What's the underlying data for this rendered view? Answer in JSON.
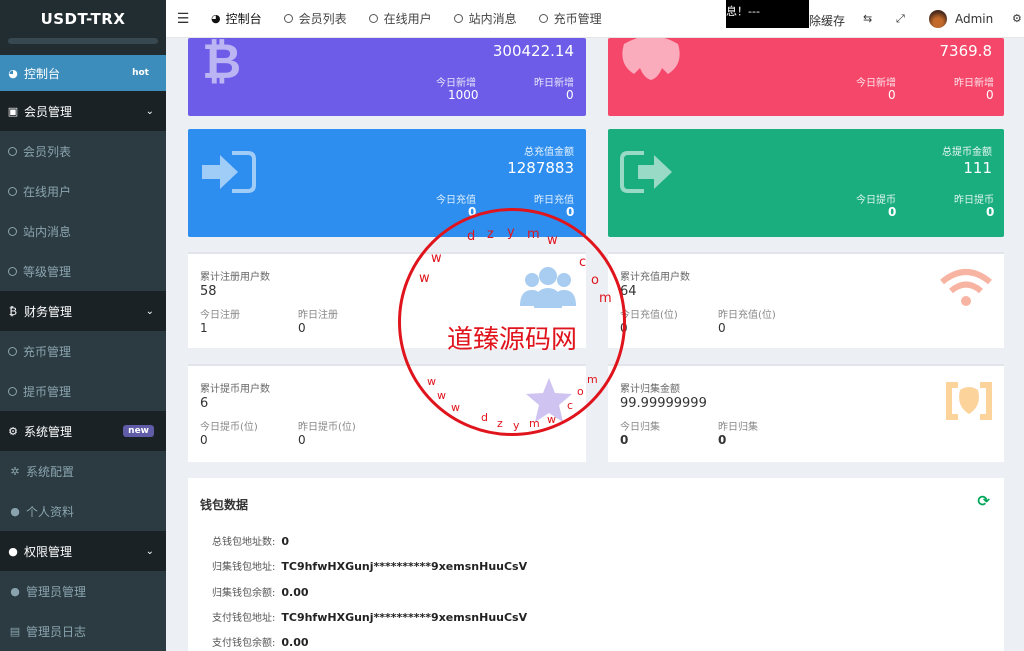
{
  "brand": "USDT-TRX",
  "sidebar": {
    "items": [
      {
        "label": "控制台",
        "badge": "hot",
        "type": "active",
        "icon": "dashboard-icon"
      },
      {
        "label": "会员管理",
        "type": "group",
        "icon": "user-card-icon"
      },
      {
        "label": "会员列表",
        "type": "sub"
      },
      {
        "label": "在线用户",
        "type": "sub"
      },
      {
        "label": "站内消息",
        "type": "sub"
      },
      {
        "label": "等级管理",
        "type": "sub"
      },
      {
        "label": "财务管理",
        "type": "group",
        "icon": "bitcoin-icon"
      },
      {
        "label": "充币管理",
        "type": "sub"
      },
      {
        "label": "提币管理",
        "type": "sub"
      },
      {
        "label": "系统管理",
        "badge": "new",
        "type": "group",
        "icon": "cogs-icon"
      },
      {
        "label": "系统配置",
        "type": "sub",
        "icon": "gear-icon"
      },
      {
        "label": "个人资料",
        "type": "sub",
        "icon": "user-icon"
      },
      {
        "label": "权限管理",
        "type": "group",
        "icon": "users-icon"
      },
      {
        "label": "管理员管理",
        "type": "sub",
        "icon": "user-icon"
      },
      {
        "label": "管理员日志",
        "type": "sub",
        "icon": "list-icon"
      }
    ]
  },
  "topbar": {
    "tabs": [
      "控制台",
      "会员列表",
      "在线用户",
      "站内消息",
      "充币管理"
    ],
    "notice": "息！---",
    "cache": "除缓存",
    "admin": "Admin"
  },
  "cards": {
    "users": {
      "total": "300422.14",
      "today_label": "今日新增",
      "today": "1000",
      "yesterday_label": "昨日新增",
      "yesterday": "0",
      "color": "#6c5ce7"
    },
    "assets": {
      "total": "7369.8",
      "today_label": "今日新增",
      "today": "0",
      "yesterday_label": "昨日新增",
      "yesterday": "0",
      "color": "#f5476a"
    },
    "recharge": {
      "total_label": "总充值金额",
      "total": "1287883",
      "today_label": "今日充值",
      "today": "0",
      "yesterday_label": "昨日充值",
      "yesterday": "0",
      "color": "#2d8ef0"
    },
    "withdraw": {
      "total_label": "总提币金额",
      "total": "111",
      "today_label": "今日提币",
      "today": "0",
      "yesterday_label": "昨日提币",
      "yesterday": "0",
      "color": "#1aae7e"
    }
  },
  "stats": {
    "reg": {
      "title": "累计注册用户数",
      "value": "58",
      "today_label": "今日注册",
      "today": "1",
      "yesterday_label": "昨日注册",
      "yesterday": "0"
    },
    "charge_users": {
      "title": "累计充值用户数",
      "value": "64",
      "today_label": "今日充值(位)",
      "today": "0",
      "yesterday_label": "昨日充值(位)",
      "yesterday": "0"
    },
    "withdraw_users": {
      "title": "累计提币用户数",
      "value": "6",
      "today_label": "今日提币(位)",
      "today": "0",
      "yesterday_label": "昨日提币(位)",
      "yesterday": "0"
    },
    "collect": {
      "title": "累计归集金额",
      "value": "99.99999999",
      "today_label": "今日归集",
      "today": "0",
      "yesterday_label": "昨日归集",
      "yesterday": "0"
    }
  },
  "wallet": {
    "title": "钱包数据",
    "rows": [
      {
        "label": "总钱包地址数:",
        "value": "0"
      },
      {
        "label": "归集钱包地址:",
        "value": "TC9hfwHXGunj**********9xemsnHuuCsV"
      },
      {
        "label": "归集钱包余额:",
        "value": "0.00"
      },
      {
        "label": "支付钱包地址:",
        "value": "TC9hfwHXGunj**********9xemsnHuuCsV"
      },
      {
        "label": "支付钱包余额:",
        "value": "0.00"
      }
    ]
  },
  "watermark": {
    "center": "道臻源码网",
    "top_letters": [
      "w",
      "w",
      "d",
      "z",
      "y",
      "m",
      "w",
      "c",
      "o",
      "m"
    ],
    "bottom_letters": [
      "w",
      "w",
      "w",
      "d",
      "z",
      "y",
      "m",
      "w",
      "c",
      "o",
      "m"
    ]
  }
}
